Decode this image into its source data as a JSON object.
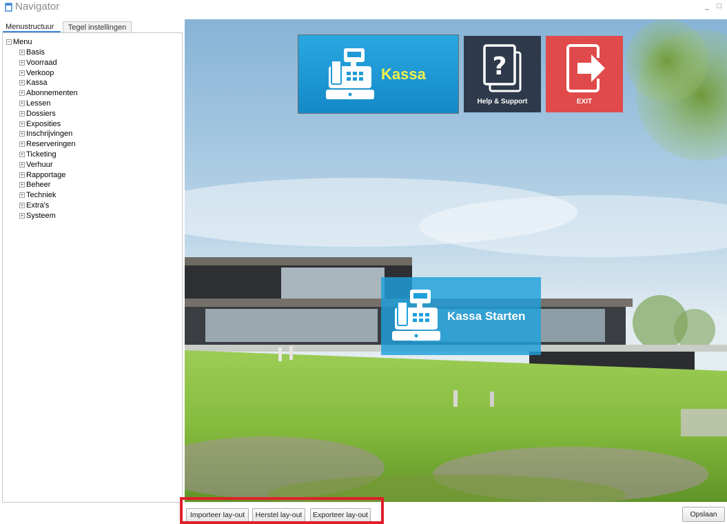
{
  "window": {
    "title": "Navigator",
    "minimize_label": "_",
    "maximize_label": "□"
  },
  "tabs": [
    {
      "label": "Menustructuur",
      "active": true
    },
    {
      "label": "Tegel instellingen",
      "active": false
    }
  ],
  "tree": {
    "root": "Menu",
    "items": [
      "Basis",
      "Voorraad",
      "Verkoop",
      "Kassa",
      "Abonnementen",
      "Lessen",
      "Dossiers",
      "Exposities",
      "Inschrijvingen",
      "Reserveringen",
      "Ticketing",
      "Verhuur",
      "Rapportage",
      "Beheer",
      "Techniek",
      "Extra's",
      "Systeem"
    ]
  },
  "tiles": {
    "kassa": {
      "label": "Kassa",
      "icon": "cash-register-icon",
      "color": "#1e9ad6",
      "text_color": "#f5f04a"
    },
    "help": {
      "label": "Help & Support",
      "icon": "help-documents-icon",
      "color": "#2e3a4b"
    },
    "exit": {
      "label": "EXIT",
      "icon": "exit-door-icon",
      "color": "#e04a4a"
    },
    "start": {
      "label": "Kassa Starten",
      "icon": "cash-register-icon",
      "color": "#1ea0dc"
    }
  },
  "buttons": {
    "import": "Importeer lay-out",
    "restore": "Herstel lay-out",
    "export": "Exporteer lay-out",
    "save": "Opslaan"
  },
  "colors": {
    "active_tab_underline": "#3d87d8",
    "highlight_border": "#e0202a"
  }
}
